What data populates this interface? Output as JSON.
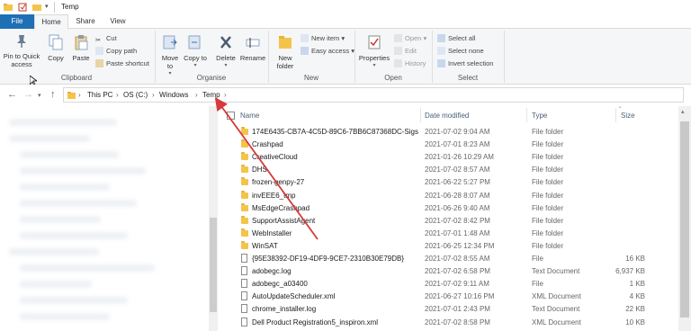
{
  "window": {
    "title": "Temp"
  },
  "tabs": [
    "File",
    "Home",
    "Share",
    "View"
  ],
  "ribbon": {
    "clipboard": {
      "label": "Clipboard",
      "pin": "Pin to Quick access",
      "copy": "Copy",
      "paste": "Paste",
      "cut": "Cut",
      "copy_path": "Copy path",
      "paste_shortcut": "Paste shortcut"
    },
    "organise": {
      "label": "Organise",
      "move_to": "Move to",
      "copy_to": "Copy to",
      "delete": "Delete",
      "rename": "Rename"
    },
    "new": {
      "label": "New",
      "new_folder": "New folder",
      "new_item": "New item",
      "easy_access": "Easy access"
    },
    "open": {
      "label": "Open",
      "properties": "Properties",
      "open": "Open",
      "edit": "Edit",
      "history": "History"
    },
    "select": {
      "label": "Select",
      "select_all": "Select all",
      "select_none": "Select none",
      "invert": "Invert selection"
    }
  },
  "breadcrumb": [
    "This PC",
    "OS (C:)",
    "Windows",
    "Temp"
  ],
  "columns": {
    "name": "Name",
    "date": "Date modified",
    "type": "Type",
    "size": "Size"
  },
  "files": [
    {
      "name": "174E6435-CB7A-4C5D-89C6-7BB6C87368DC-Sigs",
      "date": "2021-07-02 9:04 AM",
      "type": "File folder",
      "size": "",
      "kind": "folder"
    },
    {
      "name": "Crashpad",
      "date": "2021-07-01 8:23 AM",
      "type": "File folder",
      "size": "",
      "kind": "folder"
    },
    {
      "name": "CreativeCloud",
      "date": "2021-01-26 10:29 AM",
      "type": "File folder",
      "size": "",
      "kind": "folder"
    },
    {
      "name": "DHS",
      "date": "2021-07-02 8:57 AM",
      "type": "File folder",
      "size": "",
      "kind": "folder"
    },
    {
      "name": "frozen-genpy-27",
      "date": "2021-06-22 5:27 PM",
      "type": "File folder",
      "size": "",
      "kind": "folder"
    },
    {
      "name": "invEEE6_tmp",
      "date": "2021-06-28 8:07 AM",
      "type": "File folder",
      "size": "",
      "kind": "folder"
    },
    {
      "name": "MsEdgeCrashpad",
      "date": "2021-06-26 9:40 AM",
      "type": "File folder",
      "size": "",
      "kind": "folder"
    },
    {
      "name": "SupportAssistAgent",
      "date": "2021-07-02 8:42 PM",
      "type": "File folder",
      "size": "",
      "kind": "folder"
    },
    {
      "name": "WebInstaller",
      "date": "2021-07-01 1:48 AM",
      "type": "File folder",
      "size": "",
      "kind": "folder"
    },
    {
      "name": "WinSAT",
      "date": "2021-06-25 12:34 PM",
      "type": "File folder",
      "size": "",
      "kind": "folder"
    },
    {
      "name": "{95E38392-DF19-4DF9-9CE7-2310B30E79DB}",
      "date": "2021-07-02 8:55 AM",
      "type": "File",
      "size": "16 KB",
      "kind": "file"
    },
    {
      "name": "adobegc.log",
      "date": "2021-07-02 6:58 PM",
      "type": "Text Document",
      "size": "6,937 KB",
      "kind": "file"
    },
    {
      "name": "adobegc_a03400",
      "date": "2021-07-02 9:11 AM",
      "type": "File",
      "size": "1 KB",
      "kind": "file"
    },
    {
      "name": "AutoUpdateScheduler.xml",
      "date": "2021-06-27 10:16 PM",
      "type": "XML Document",
      "size": "4 KB",
      "kind": "file"
    },
    {
      "name": "chrome_installer.log",
      "date": "2021-07-01 2:43 PM",
      "type": "Text Document",
      "size": "22 KB",
      "kind": "file"
    },
    {
      "name": "Dell Product Registration5_inspiron.xml",
      "date": "2021-07-02 8:58 PM",
      "type": "XML Document",
      "size": "10 KB",
      "kind": "file"
    }
  ],
  "colors": {
    "file_tab": "#1f6fb5",
    "arrow": "#d63a3a",
    "header_text": "#4c607a"
  },
  "annotation_arrow": {
    "from": "WebInstaller row",
    "to": "Temp breadcrumb"
  }
}
